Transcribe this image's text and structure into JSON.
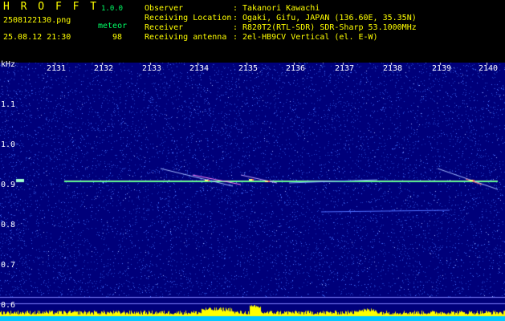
{
  "header": {
    "brand": "H R O F F T",
    "version": "1.0.0",
    "filename": "2508122130.png",
    "datetime": "25.08.12 21:30",
    "mode_label": "meteor",
    "count": "98",
    "info": [
      {
        "label": "Observer",
        "sep": ":",
        "value": "Takanori Kawachi"
      },
      {
        "label": "Receiving Location",
        "sep": ":",
        "value": "Ogaki, Gifu, JAPAN (136.60E, 35.35N)"
      },
      {
        "label": "Receiver",
        "sep": ":",
        "value": "R820T2(RTL-SDR) SDR-Sharp 53.1000MHz"
      },
      {
        "label": "Receiving antenna",
        "sep": ":",
        "value": "2el-HB9CV Vertical (el. E-W)"
      }
    ]
  },
  "axes": {
    "unit": "kHz",
    "x_ticks": [
      "2131",
      "2132",
      "2133",
      "2134",
      "2135",
      "2136",
      "2137",
      "2138",
      "2139",
      "2140"
    ],
    "y_ticks": [
      "1.1",
      "1.0",
      "0.9",
      "0.8",
      "0.7",
      "0.6"
    ]
  },
  "colors": {
    "background": "#00007a",
    "noise": "#3060ff",
    "carrier": "#a0ffb0",
    "bar_bottom": "#00c8ff",
    "bar_top": "#ffff00"
  }
}
